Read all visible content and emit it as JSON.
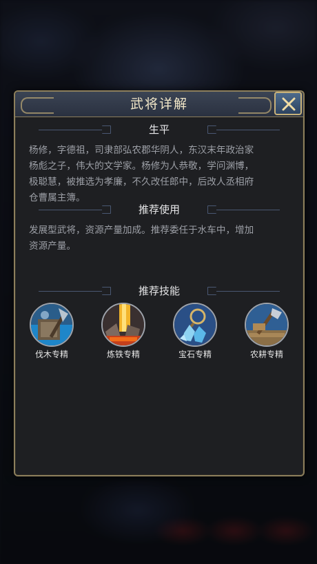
{
  "modal": {
    "title": "武将详解",
    "close_icon": "close-x-icon"
  },
  "biography": {
    "heading": "生平",
    "lines": [
      "杨修，字德祖，司隶部弘农郡华阴人，东汉末年政治家",
      "杨彪之子，伟大的文学家。杨修为人恭敬，学问渊博，",
      "极聪慧，被推选为孝廉，不久改任郎中，后改人丞相府",
      "仓曹属主簿。"
    ]
  },
  "usage": {
    "heading": "推荐使用",
    "lines": [
      "发展型武将，资源产量加成。推荐委任于水车中，增加",
      "资源产量。"
    ]
  },
  "skills": {
    "heading": "推荐技能",
    "items": [
      {
        "label": "伐木专精",
        "icon": "axe-logging-icon"
      },
      {
        "label": "炼铁专精",
        "icon": "iron-smelting-icon"
      },
      {
        "label": "宝石专精",
        "icon": "gemstone-icon"
      },
      {
        "label": "农耕专精",
        "icon": "farming-hoe-icon"
      }
    ]
  },
  "colors": {
    "frame_gold": "#8d7f5c",
    "header_blue": "#3b4454",
    "text_muted": "#9c9fa6"
  }
}
